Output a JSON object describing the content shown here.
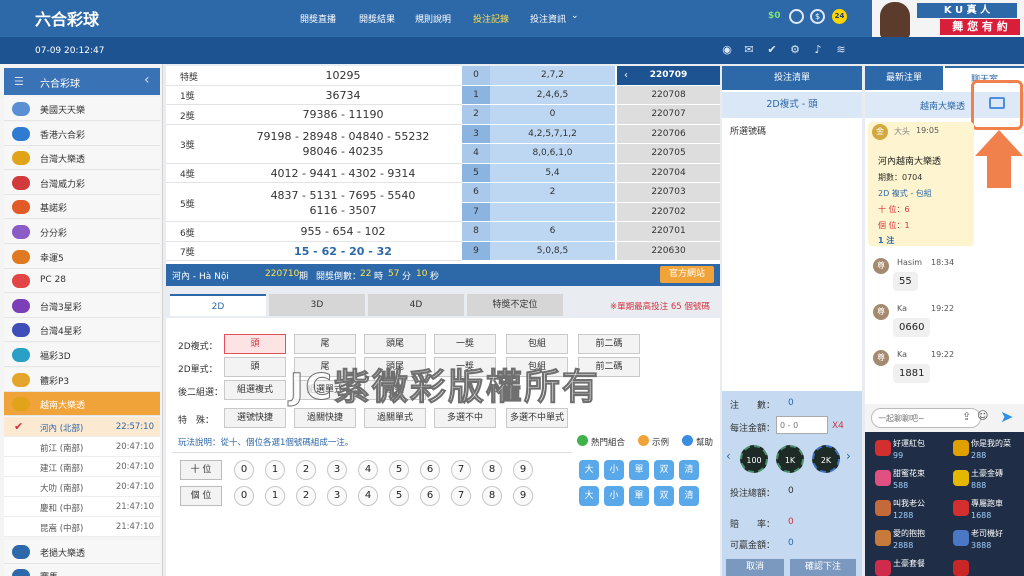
{
  "brand": {
    "title": "六合彩球",
    "ad_line1": "K U 真 人",
    "ad_line2": "舞 您 有 約"
  },
  "nav": [
    "開獎直播",
    "開獎結果",
    "規則說明",
    "投注記錄",
    "投注資訊"
  ],
  "nav_active_index": 3,
  "topright": {
    "balance": "$0",
    "badge": "24"
  },
  "datetime": "07-09 20:12:47",
  "sidebar": {
    "header": "六合彩球",
    "items": [
      {
        "label": "美國天天樂",
        "icon": "usa-lottery-icon",
        "color": "#5b8fd4"
      },
      {
        "label": "香港六合彩",
        "icon": "hk-mark6-icon",
        "color": "#2f7bd2"
      },
      {
        "label": "台灣大樂透",
        "icon": "tw-lotto-icon",
        "color": "#e0a31a"
      },
      {
        "label": "台灣威力彩",
        "icon": "tw-power-icon",
        "color": "#d23b3b"
      },
      {
        "label": "基諾彩",
        "icon": "keno-icon",
        "color": "#e25a25"
      },
      {
        "label": "分分彩",
        "icon": "minute-lottery-icon",
        "color": "#8a5cc5"
      },
      {
        "label": "幸運5",
        "icon": "lucky5-icon",
        "color": "#e07a22"
      },
      {
        "label": "PC 28",
        "icon": "pc28-icon",
        "color": "#e24545"
      },
      {
        "label": "台灣3星彩",
        "icon": "tw-3star-icon",
        "color": "#7b3fb7"
      },
      {
        "label": "台灣4星彩",
        "icon": "tw-4star-icon",
        "color": "#3f4fb7"
      },
      {
        "label": "福彩3D",
        "icon": "welfare-3d-icon",
        "color": "#2aa0c7"
      },
      {
        "label": "體彩P3",
        "icon": "sports-p3-icon",
        "color": "#e3a52b"
      },
      {
        "label": "越南大樂透",
        "icon": "vn-lotto-icon",
        "color": "#e0a31a"
      }
    ],
    "subitems": [
      {
        "label": "河內 (北部)",
        "time": "22:57:10"
      },
      {
        "label": "前江 (南部)",
        "time": "20:47:10"
      },
      {
        "label": "建江 (南部)",
        "time": "20:47:10"
      },
      {
        "label": "大叻 (南部)",
        "time": "20:47:10"
      },
      {
        "label": "慶和 (中部)",
        "time": "21:47:10"
      },
      {
        "label": "昆嵩 (中部)",
        "time": "21:47:10"
      }
    ],
    "bottom_items": [
      {
        "label": "老撾大樂透",
        "icon": "laos-lotto-icon",
        "color": "#2d68a8"
      },
      {
        "label": "賽馬",
        "icon": "horse-racing-icon",
        "color": "#2d68a8"
      }
    ]
  },
  "results": [
    {
      "label": "特獎",
      "numbers": [
        "10295"
      ]
    },
    {
      "label": "1獎",
      "numbers": [
        "36734"
      ]
    },
    {
      "label": "2獎",
      "numbers": [
        "79386 - 11190"
      ]
    },
    {
      "label": "3獎",
      "numbers": [
        "79198 - 28948 - 04840 - 55232",
        "98046 - 40235"
      ]
    },
    {
      "label": "4獎",
      "numbers": [
        "4012 - 9441 - 4302 - 9314"
      ]
    },
    {
      "label": "5獎",
      "numbers": [
        "4837 - 5131 - 7695 - 5540",
        "6116 - 3507"
      ]
    },
    {
      "label": "6獎",
      "numbers": [
        "955 - 654 - 102"
      ]
    },
    {
      "label": "7獎",
      "numbers": [
        "15 - 62 - 20 - 32"
      ]
    }
  ],
  "heads": [
    {
      "d": "0",
      "v": "2,7,2",
      "p": "220709"
    },
    {
      "d": "1",
      "v": "2,4,6,5",
      "p": "220708"
    },
    {
      "d": "2",
      "v": "0",
      "p": "220707"
    },
    {
      "d": "3",
      "v": "4,2,5,7,1,2",
      "p": "220706"
    },
    {
      "d": "4",
      "v": "8,0,6,1,0",
      "p": "220705"
    },
    {
      "d": "5",
      "v": "5,4",
      "p": "220704"
    },
    {
      "d": "6",
      "v": "2",
      "p": "220703"
    },
    {
      "d": "7",
      "v": "",
      "p": "220702"
    },
    {
      "d": "8",
      "v": "6",
      "p": "220701"
    },
    {
      "d": "9",
      "v": "5,0,8,5",
      "p": "220630"
    }
  ],
  "info": {
    "region": "河內 - Hà Nội",
    "period": "220710",
    "period_suffix": "期",
    "countdown_label": "開獎倒數：",
    "h": "22",
    "h_unit": "時",
    "m": "57",
    "m_unit": "分",
    "s": "10",
    "s_unit": "秒",
    "official_btn": "官方網站"
  },
  "tabs": [
    "2D",
    "3D",
    "4D",
    "特獎不定位"
  ],
  "tab_note": "※單期最高投注 65 個號碼",
  "bet_rows": [
    {
      "label": "2D複式：",
      "opts": [
        "頭",
        "尾",
        "頭尾",
        "一獎",
        "包組",
        "前二碼"
      ]
    },
    {
      "label": "2D單式：",
      "opts": [
        "頭",
        "尾",
        "頭尾",
        "一獎",
        "包組",
        "前二碼"
      ]
    },
    {
      "label": "後二組選：",
      "opts": [
        "組選複式",
        "組選單式",
        "快捷"
      ]
    },
    {
      "label": "特　殊：",
      "opts": [
        "選號快捷",
        "過關快捷",
        "過關單式",
        "多選不中",
        "多選不中單式"
      ]
    }
  ],
  "play_note": "玩法說明：從十、個位各選1個號碼組成一注。",
  "links": [
    "熱門組合",
    "示例",
    "幫助"
  ],
  "positions": [
    "十 位",
    "個 位"
  ],
  "balls": [
    "0",
    "1",
    "2",
    "3",
    "4",
    "5",
    "6",
    "7",
    "8",
    "9"
  ],
  "quick": [
    "大",
    "小",
    "單",
    "双",
    "清"
  ],
  "slip": {
    "title": "投注清單",
    "type": "2D複式 - 頭",
    "selected_label": "所選號碼",
    "count_label": "注　　數：",
    "count": "0",
    "amount_label": "每注金額：",
    "amount_placeholder": "0 - 0",
    "multiplier": "X4",
    "chips": [
      "100",
      "1K",
      "2K"
    ],
    "total_label": "投注總額：",
    "total": "0",
    "rate_label": "賠　　率：",
    "rate": "0",
    "win_label": "可贏金額：",
    "win": "0",
    "cancel": "取消",
    "confirm": "確認下注"
  },
  "chat": {
    "tabs": [
      "最新注單",
      "聊天室"
    ],
    "room": "越南大樂透",
    "featured": {
      "user": "大头",
      "time": "19:05",
      "title": "河內越南大樂透",
      "period": "期數：0704",
      "type": "2D 複式 - 包組",
      "ten": "十 位：6",
      "one": "個 位：1",
      "count": "1 注"
    },
    "messages": [
      {
        "user": "Hasim",
        "time": "18:34",
        "text": "55"
      },
      {
        "user": "Ka",
        "time": "19:22",
        "text": "0660"
      },
      {
        "user": "Ka",
        "time": "19:22",
        "text": "1881"
      }
    ],
    "placeholder": "一起聊聊吧~",
    "gifts": [
      {
        "name": "好運紅包",
        "value": "99",
        "color": "#d32f2f"
      },
      {
        "name": "你是我的菜",
        "value": "288",
        "color": "#e0a000"
      },
      {
        "name": "甜蜜花束",
        "value": "588",
        "color": "#e05080"
      },
      {
        "name": "土豪金磚",
        "value": "888",
        "color": "#e5b800"
      },
      {
        "name": "叫我老公",
        "value": "1288",
        "color": "#c46a3a"
      },
      {
        "name": "專屬跑車",
        "value": "1688",
        "color": "#d32f2f"
      },
      {
        "name": "愛的抱抱",
        "value": "2888",
        "color": "#c77a3a"
      },
      {
        "name": "老司機好",
        "value": "3888",
        "color": "#4a78c5"
      },
      {
        "name": "土豪套餐",
        "value": "",
        "color": "#d02b4a"
      },
      {
        "name": "",
        "value": "",
        "color": "#c92626"
      }
    ]
  },
  "watermark": "JC紫微彩版權所有"
}
